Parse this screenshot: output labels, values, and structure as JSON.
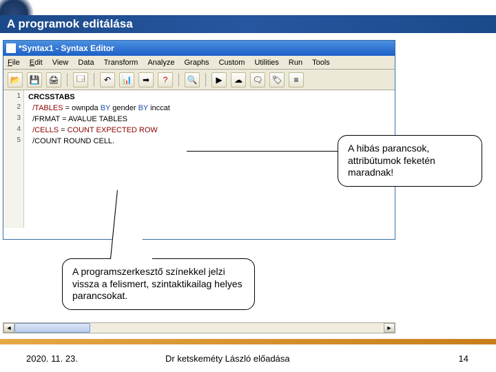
{
  "slide": {
    "title": "A programok editálása"
  },
  "window": {
    "title": "*Syntax1 - Syntax Editor"
  },
  "menu": {
    "file": "File",
    "edit": "Edit",
    "view": "View",
    "data": "Data",
    "transform": "Transform",
    "analyze": "Analyze",
    "graphs": "Graphs",
    "custom": "Custom",
    "utilities": "Utilities",
    "run": "Run",
    "tools": "Tools"
  },
  "gutter": {
    "l1": "1",
    "l2": "2",
    "l3": "3",
    "l4": "4",
    "l5": "5"
  },
  "code": {
    "l1": {
      "cmd": "CRCSSTABS"
    },
    "l2": {
      "k": "/TABLES",
      "eq": " = ",
      "v1": "ownpda",
      "by1": " BY ",
      "v2": "gender",
      "by2": " BY ",
      "v3": "inccat"
    },
    "l3": {
      "k": "/FRMAT",
      "rest": " = AVALUE TABLES"
    },
    "l4": {
      "k": "/CELLS",
      "eq": " = ",
      "rest": "COUNT EXPECTED ROW"
    },
    "l5": {
      "k": "/COUNT",
      "rest": " ROUND CELL."
    }
  },
  "callout": {
    "bottom": "A programszerkesztő színekkel jelzi vissza a felismert, szintaktikailag helyes parancsokat.",
    "right": "A hibás parancsok, attribútumok feketén maradnak!"
  },
  "footer": {
    "date": "2020. 11. 23.",
    "author": "Dr ketskeméty László előadása",
    "page": "14"
  }
}
